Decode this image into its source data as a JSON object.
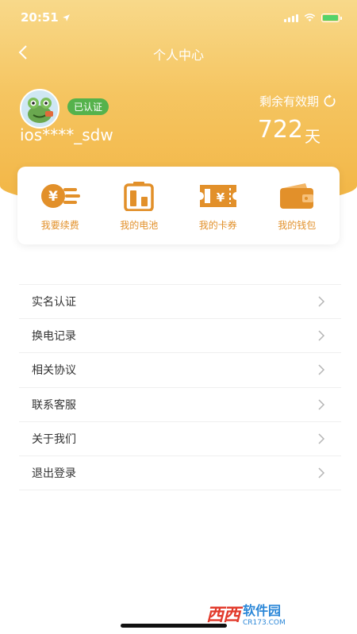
{
  "status_bar": {
    "time": "20:51"
  },
  "nav": {
    "title": "个人中心"
  },
  "profile": {
    "verified_label": "已认证",
    "username": "ios****_sdw"
  },
  "validity": {
    "label": "剩余有效期",
    "days": "722",
    "unit": "天"
  },
  "quick_actions": [
    {
      "label": "我要续费",
      "icon": "renew-payment-icon"
    },
    {
      "label": "我的电池",
      "icon": "battery-icon"
    },
    {
      "label": "我的卡券",
      "icon": "coupon-ticket-icon"
    },
    {
      "label": "我的钱包",
      "icon": "wallet-icon"
    }
  ],
  "menu": [
    {
      "label": "实名认证"
    },
    {
      "label": "换电记录"
    },
    {
      "label": "相关协议"
    },
    {
      "label": "联系客服"
    },
    {
      "label": "关于我们"
    },
    {
      "label": "退出登录"
    }
  ],
  "watermark": {
    "brand": "软件园",
    "url": "CR173.COM",
    "logo": "西西"
  },
  "colors": {
    "accent": "#f2b544",
    "icon_orange": "#e2902a",
    "badge_green": "#55b24c"
  }
}
